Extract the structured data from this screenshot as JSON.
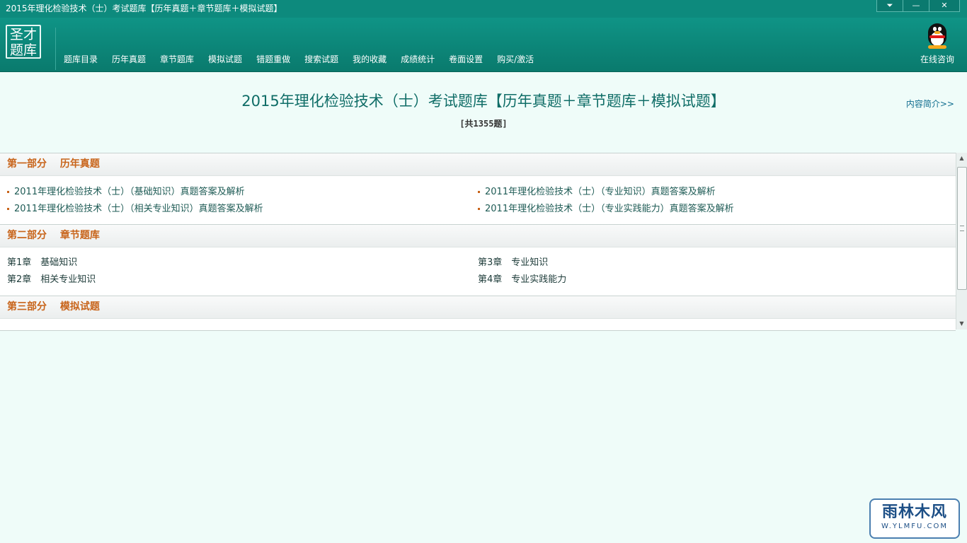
{
  "window": {
    "title": "2015年理化检验技术（士）考试题库【历年真题＋章节题库＋模拟试题】",
    "controls": {
      "menu": "⏷",
      "minimize": "—",
      "close": "✕"
    }
  },
  "header": {
    "logo_text_line1": "圣才",
    "logo_text_line2": "题库",
    "nav": [
      {
        "label": "题库目录"
      },
      {
        "label": "历年真题"
      },
      {
        "label": "章节题库"
      },
      {
        "label": "模拟试题"
      },
      {
        "label": "错题重做"
      },
      {
        "label": "搜索试题"
      },
      {
        "label": "我的收藏"
      },
      {
        "label": "成绩统计"
      },
      {
        "label": "卷面设置"
      },
      {
        "label": "购买/激活"
      }
    ],
    "consult_label": "在线咨询",
    "consult_icon": "qq-penguin-icon"
  },
  "main": {
    "title": "2015年理化检验技术（士）考试题库【历年真题＋章节题库＋模拟试题】",
    "count": "[共1355题]",
    "intro_link": "内容简介>>",
    "sections": [
      {
        "heading": "第一部分　 历年真题",
        "items": [
          "2011年理化检验技术（士）（基础知识）真题答案及解析",
          "2011年理化检验技术（士）（专业知识）真题答案及解析",
          "2011年理化检验技术（士）（相关专业知识）真题答案及解析",
          "2011年理化检验技术（士）（专业实践能力）真题答案及解析"
        ]
      },
      {
        "heading": "第二部分　 章节题库",
        "items": [
          "第1章　基础知识",
          "第3章　专业知识",
          "第2章　相关专业知识",
          "第4章　专业实践能力"
        ]
      },
      {
        "heading": "第三部分　 模拟试题",
        "items": []
      }
    ]
  },
  "watermark": {
    "main": "雨林木风",
    "sub": "W.YLMFU.COM"
  }
}
